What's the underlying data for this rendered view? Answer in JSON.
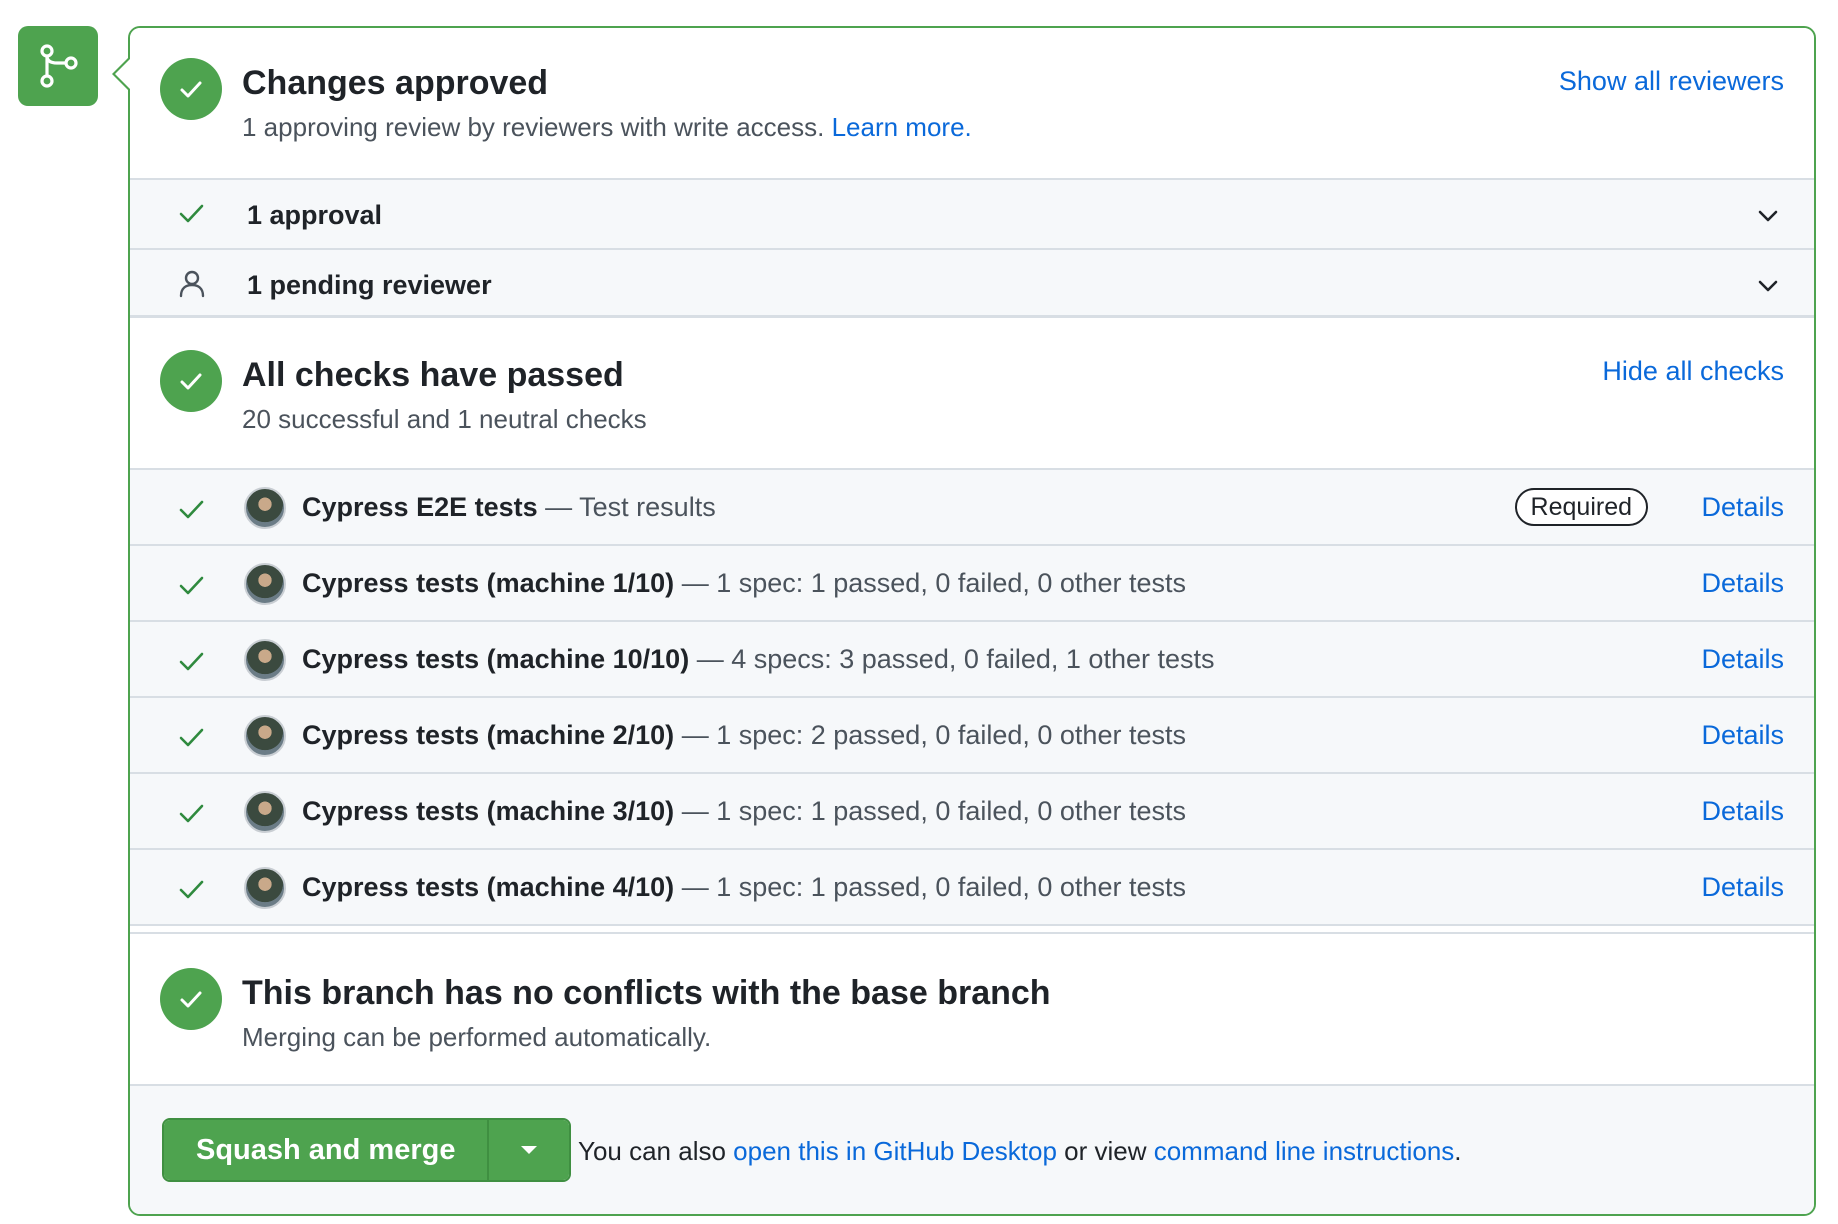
{
  "approvals": {
    "title": "Changes approved",
    "subtitle": "1 approving review by reviewers with write access.",
    "learn_more": "Learn more.",
    "show_all_reviewers": "Show all reviewers",
    "rows": [
      {
        "label": "1 approval"
      },
      {
        "label": "1 pending reviewer"
      }
    ]
  },
  "checks": {
    "title": "All checks have passed",
    "subtitle": "20 successful and 1 neutral checks",
    "hide_all_checks": "Hide all checks",
    "required_label": "Required",
    "details_label": "Details",
    "items": [
      {
        "name": "Cypress E2E tests",
        "desc": " — Test results"
      },
      {
        "name": "Cypress tests (machine 1/10)",
        "desc": " — 1 spec: 1 passed, 0 failed, 0 other tests"
      },
      {
        "name": "Cypress tests (machine 10/10)",
        "desc": " — 4 specs: 3 passed, 0 failed, 1 other tests"
      },
      {
        "name": "Cypress tests (machine 2/10)",
        "desc": " — 1 spec: 2 passed, 0 failed, 0 other tests"
      },
      {
        "name": "Cypress tests (machine 3/10)",
        "desc": " — 1 spec: 1 passed, 0 failed, 0 other tests"
      },
      {
        "name": "Cypress tests (machine 4/10)",
        "desc": " — 1 spec: 1 passed, 0 failed, 0 other tests"
      }
    ]
  },
  "conflicts": {
    "title": "This branch has no conflicts with the base branch",
    "subtitle": "Merging can be performed automatically."
  },
  "merge": {
    "button_label": "Squash and merge",
    "text_prefix": "You can also ",
    "desktop_link": "open this in GitHub Desktop",
    "text_middle": " or view ",
    "cli_link": "command line instructions",
    "text_suffix": "."
  },
  "icons": {
    "merge": "git-branch-icon",
    "status": "check-circle-icon",
    "check": "check-icon",
    "person": "person-icon",
    "chevron": "chevron-down-icon"
  },
  "colors": {
    "success": "#4ea34f",
    "link": "#0a69da",
    "muted": "#4b535c",
    "row_bg": "#f6f8fa",
    "border": "#d8dee4"
  }
}
